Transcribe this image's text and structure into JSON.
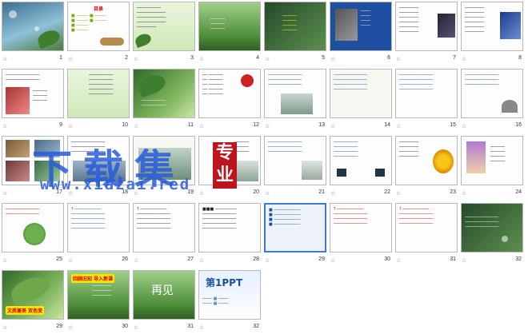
{
  "thumbnails": [
    {
      "n": "1"
    },
    {
      "n": "2"
    },
    {
      "n": "3"
    },
    {
      "n": "4"
    },
    {
      "n": "5"
    },
    {
      "n": "6"
    },
    {
      "n": "7"
    },
    {
      "n": "8"
    },
    {
      "n": "9"
    },
    {
      "n": "10"
    },
    {
      "n": "11"
    },
    {
      "n": "12"
    },
    {
      "n": "13"
    },
    {
      "n": "14"
    },
    {
      "n": "15"
    },
    {
      "n": "16"
    },
    {
      "n": "17"
    },
    {
      "n": "18"
    },
    {
      "n": "19"
    },
    {
      "n": "20"
    },
    {
      "n": "21"
    },
    {
      "n": "22"
    },
    {
      "n": "23"
    },
    {
      "n": "24"
    },
    {
      "n": "25"
    },
    {
      "n": "26"
    },
    {
      "n": "27"
    },
    {
      "n": "28"
    },
    {
      "n": "29"
    },
    {
      "n": "30"
    },
    {
      "n": "31"
    },
    {
      "n": "32"
    }
  ],
  "slide_text": {
    "s2_title": "目录",
    "s31_text": "再见",
    "s32_title": "第1PPT",
    "s29_badge": "文质兼美 双色变",
    "s30_badge": "回顾旧知 导入新课"
  },
  "watermark": {
    "main": "下载集",
    "url": "www.xiazai.red",
    "seal": "专业"
  },
  "star_glyph": "☆"
}
